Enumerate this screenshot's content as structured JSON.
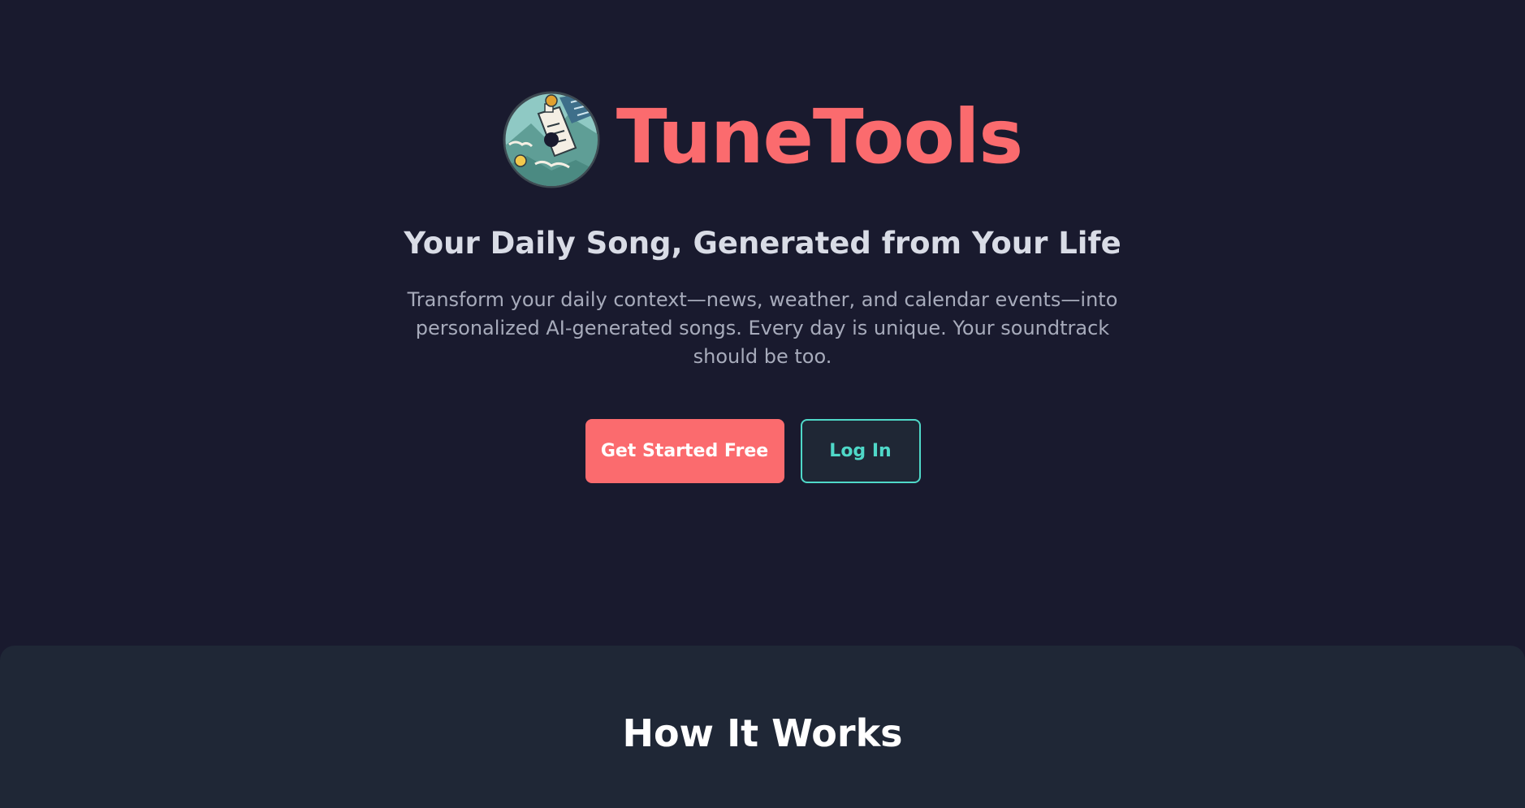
{
  "brand": {
    "name": "TuneTools",
    "logo_icon": "vinyl-record-icon",
    "accent_color": "#fb6b6e"
  },
  "hero": {
    "tagline": "Your Daily Song, Generated from Your Life",
    "description": "Transform your daily context—news, weather, and calendar events—into personalized AI-generated songs. Every day is unique. Your soundtrack should be too."
  },
  "actions": {
    "primary_label": "Get Started Free",
    "secondary_label": "Log In",
    "secondary_color": "#4fd8c8"
  },
  "how_it_works": {
    "title": "How It Works"
  }
}
